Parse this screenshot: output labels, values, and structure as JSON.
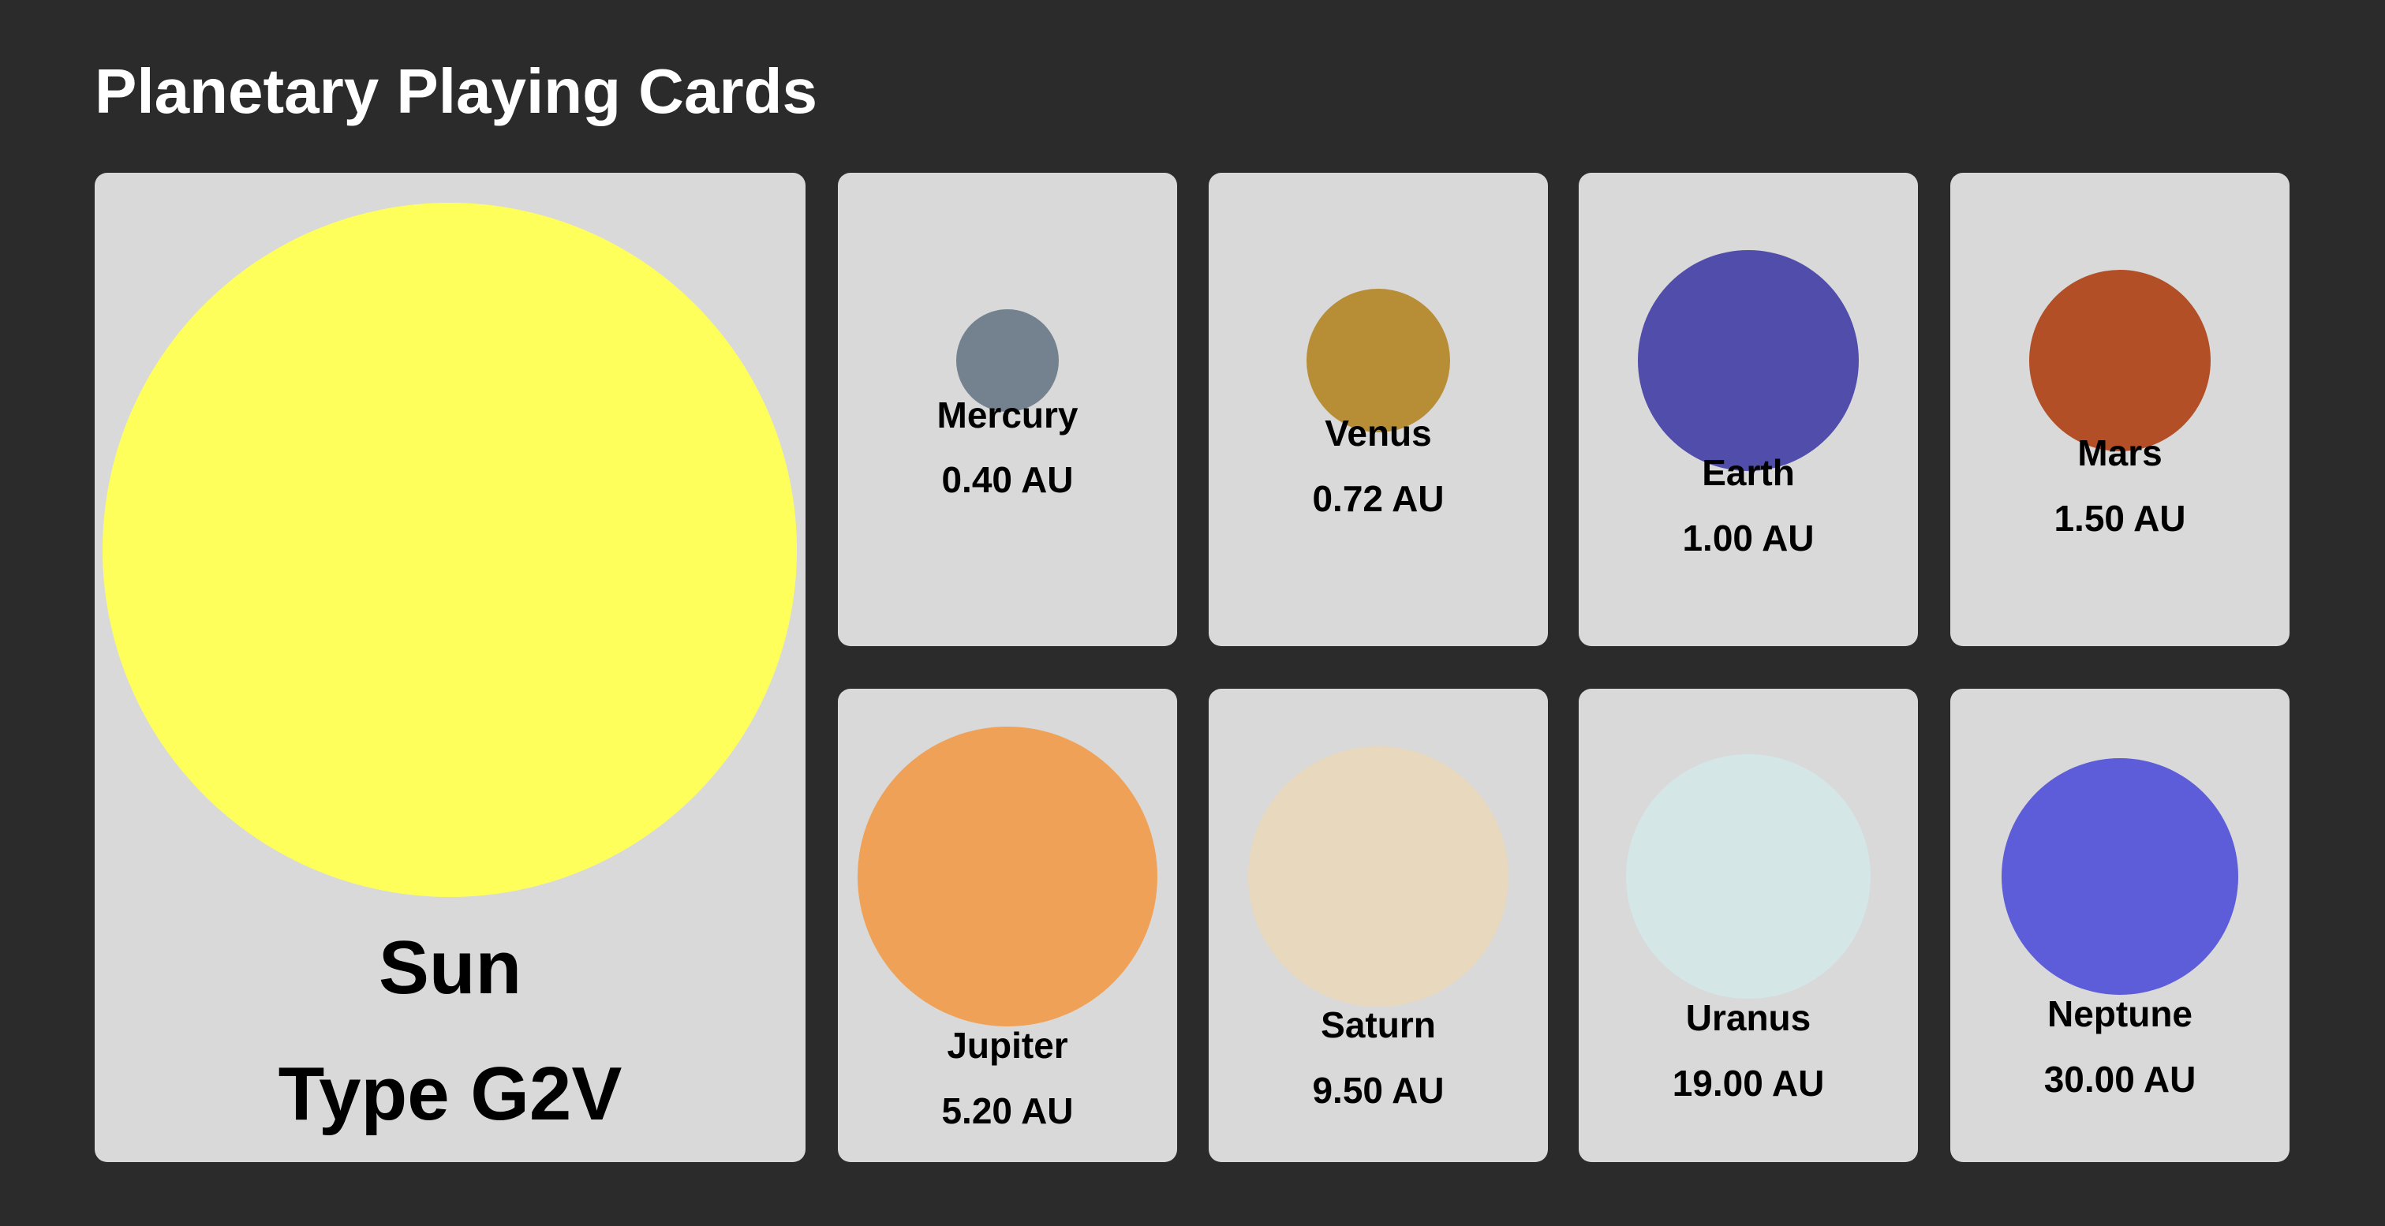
{
  "title": "Planetary Playing Cards",
  "sun": {
    "name": "Sun",
    "subtitle": "Type G2V",
    "color": "#ffff5c"
  },
  "planets": [
    {
      "name": "Mercury",
      "distance": "0.40 AU",
      "color": "#73828e"
    },
    {
      "name": "Venus",
      "distance": "0.72 AU",
      "color": "#b78e36"
    },
    {
      "name": "Earth",
      "distance": "1.00 AU",
      "color": "#504dab"
    },
    {
      "name": "Mars",
      "distance": "1.50 AU",
      "color": "#b24f26"
    },
    {
      "name": "Jupiter",
      "distance": "5.20 AU",
      "color": "#efa257"
    },
    {
      "name": "Saturn",
      "distance": "9.50 AU",
      "color": "#e8d8bd"
    },
    {
      "name": "Uranus",
      "distance": "19.00 AU",
      "color": "#d4e6e6"
    },
    {
      "name": "Neptune",
      "distance": "30.00 AU",
      "color": "#5d5dd9"
    }
  ]
}
